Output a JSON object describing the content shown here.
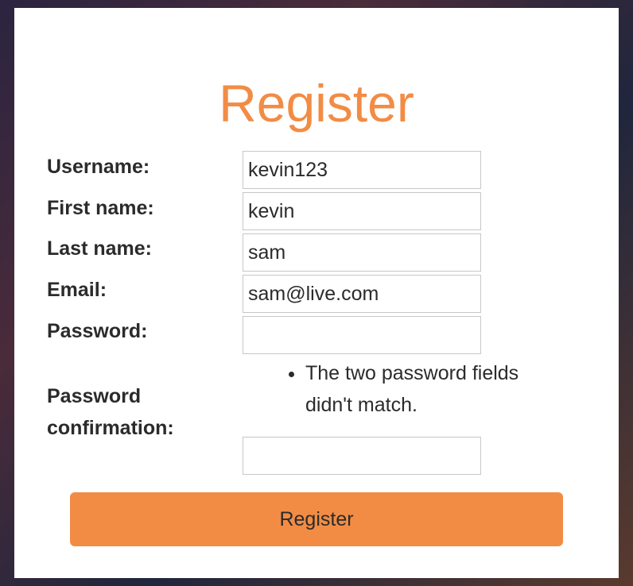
{
  "page": {
    "title": "Register"
  },
  "form": {
    "username": {
      "label": "Username:",
      "value": "kevin123"
    },
    "first_name": {
      "label": "First name:",
      "value": "kevin"
    },
    "last_name": {
      "label": "Last name:",
      "value": "sam"
    },
    "email": {
      "label": "Email:",
      "value": "sam@live.com"
    },
    "password": {
      "label": "Password:",
      "value": ""
    },
    "password_confirmation": {
      "label_line1": "Password",
      "label_line2": "confirmation:",
      "value": "",
      "error": "The two password fields didn't match."
    },
    "submit_label": "Register"
  },
  "colors": {
    "accent": "#f28c45",
    "text": "#2b2b2b",
    "panel": "#ffffff"
  }
}
